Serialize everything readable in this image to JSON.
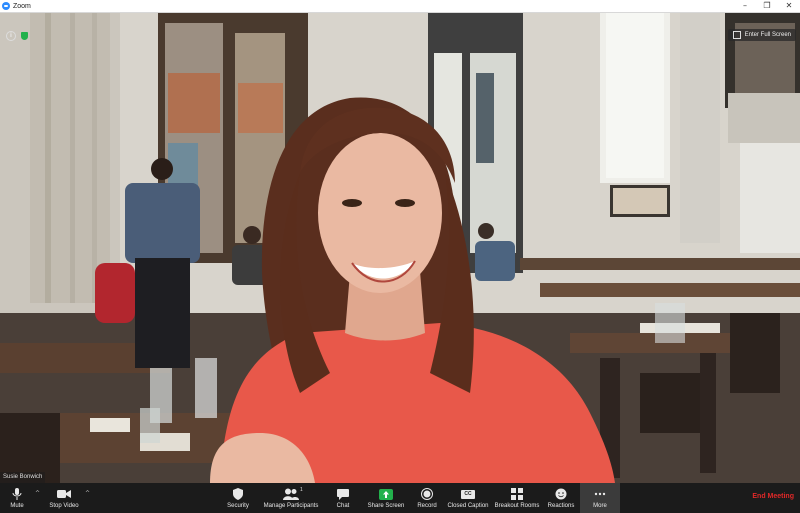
{
  "window": {
    "title": "Zoom",
    "controls": [
      "–",
      "❐",
      "✕"
    ]
  },
  "video": {
    "fullscreen_label": "Enter Full Screen",
    "participant_name": "Susie Bonwich"
  },
  "toolbar": {
    "mute": "Mute",
    "stop_video": "Stop Video",
    "security": "Security",
    "manage_participants": "Manage Participants",
    "participant_count": "1",
    "chat": "Chat",
    "share_screen": "Share Screen",
    "record": "Record",
    "closed_caption": "Closed Caption",
    "cc_text": "CC",
    "breakout_rooms": "Breakout Rooms",
    "reactions": "Reactions",
    "more": "More",
    "end_meeting": "End Meeting"
  },
  "colors": {
    "accent": "#2d8cff",
    "end_meeting": "#e02828",
    "share": "#22b14c",
    "shirt": "#e8584a"
  }
}
